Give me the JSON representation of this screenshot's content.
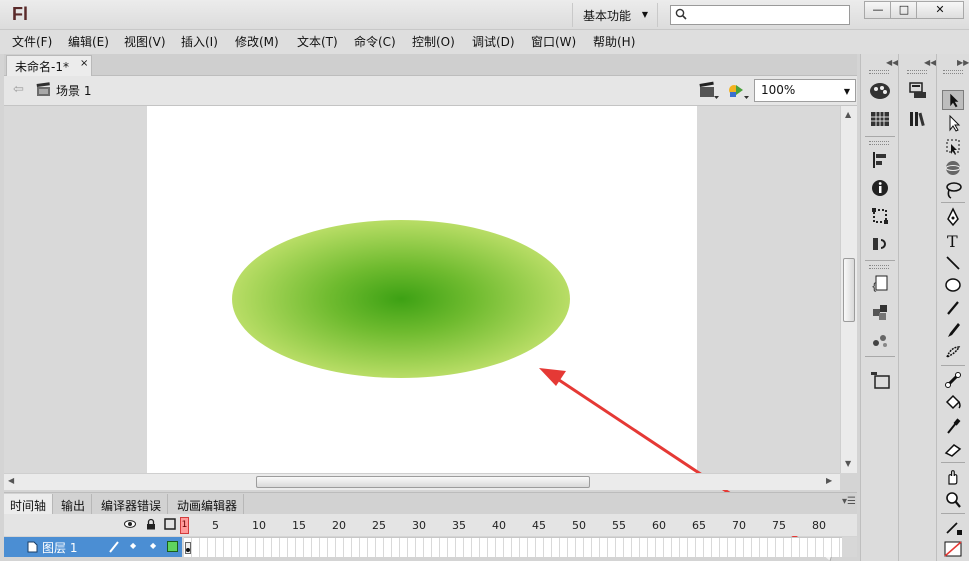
{
  "app": {
    "logo_text": "Fl",
    "workspace": "基本功能",
    "search_placeholder": ""
  },
  "window_controls": {
    "minimize": "—",
    "maximize": "□",
    "close": "✕"
  },
  "menu": [
    {
      "label": "文件(F)"
    },
    {
      "label": "编辑(E)"
    },
    {
      "label": "视图(V)"
    },
    {
      "label": "插入(I)"
    },
    {
      "label": "修改(M)"
    },
    {
      "label": "文本(T)"
    },
    {
      "label": "命令(C)"
    },
    {
      "label": "控制(O)"
    },
    {
      "label": "调试(D)"
    },
    {
      "label": "窗口(W)"
    },
    {
      "label": "帮助(H)"
    }
  ],
  "document": {
    "tab_title": "未命名-1*",
    "tab_close": "×",
    "scene_label": "场景 1",
    "zoom": "100%"
  },
  "stage": {
    "background": "#ffffff",
    "shape": "gradient-ellipse",
    "gradient_center_color": "#3da114",
    "gradient_edge_color": "#eef590",
    "annotation_color": "#e53935"
  },
  "bottom_panel": {
    "tabs": [
      {
        "label": "时间轴",
        "active": true
      },
      {
        "label": "输出"
      },
      {
        "label": "编译器错误"
      },
      {
        "label": "动画编辑器"
      }
    ],
    "playhead_frame": "1",
    "frame_numbers": [
      "5",
      "10",
      "15",
      "20",
      "25",
      "30",
      "35",
      "40",
      "45",
      "50",
      "55",
      "60",
      "65",
      "70",
      "75",
      "80"
    ],
    "layer": {
      "name": "图层 1",
      "selected_color": "#4b8ed3"
    }
  },
  "right_panels": {
    "group1": [
      "color-swatch-icon",
      "swatches-grid-icon",
      "align-icon",
      "info-icon",
      "transform-icon",
      "motion-presets-icon",
      "code-snippets-icon",
      "components-icon",
      "behaviors-icon",
      "library-folder-icon"
    ],
    "group2": [
      "properties-icon",
      "library-icon"
    ],
    "tools": [
      "selection-tool",
      "subselection-tool",
      "free-transform-tool",
      "3d-rotation-tool",
      "lasso-tool",
      "pen-tool",
      "text-tool",
      "line-tool",
      "oval-tool",
      "pencil-tool",
      "brush-tool",
      "deco-tool",
      "bone-tool",
      "paint-bucket-tool",
      "eyedropper-tool",
      "eraser-tool",
      "hand-tool",
      "zoom-tool",
      "stroke-color-tool",
      "fill-color-tool"
    ]
  }
}
